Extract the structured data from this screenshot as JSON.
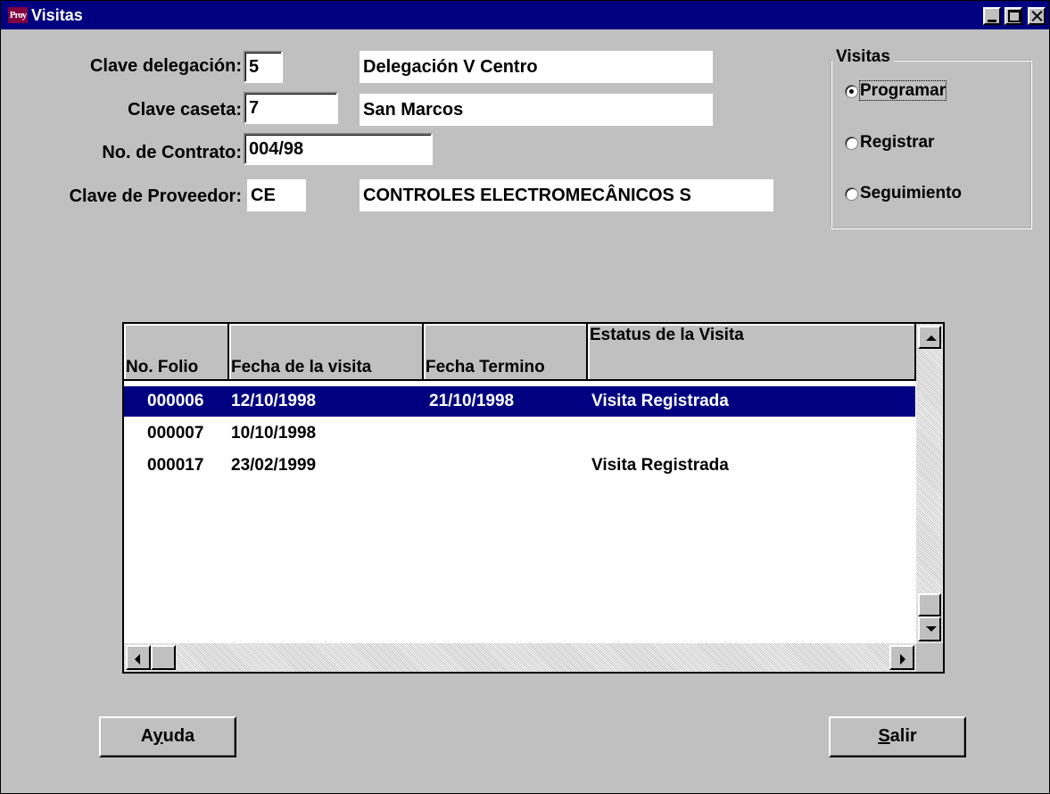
{
  "window": {
    "title": "Visitas",
    "icon_text": "Proy",
    "icon": "app-logo-icon",
    "controls": [
      "minimize-icon",
      "maximize-icon",
      "close-icon"
    ]
  },
  "form": {
    "delegacion_label": "Clave delegación:",
    "delegacion_code": "5",
    "delegacion_name": "Delegación V Centro",
    "caseta_label": "Clave caseta:",
    "caseta_code": "7",
    "caseta_name": "San Marcos",
    "contrato_label": "No. de Contrato:",
    "contrato_value": "004/98",
    "proveedor_label": "Clave de Proveedor:",
    "proveedor_code": "CE",
    "proveedor_name": "CONTROLES ELECTROMECÂNICOS S"
  },
  "visitas_group": {
    "label": "Visitas",
    "options": [
      {
        "label": "Programar",
        "selected": true
      },
      {
        "label": "Registrar",
        "selected": false
      },
      {
        "label": "Seguimiento",
        "selected": false
      }
    ]
  },
  "grid": {
    "columns": [
      "No. Folio",
      "Fecha de la visita",
      "Fecha Termino",
      "Estatus de la Visita"
    ],
    "rows": [
      {
        "folio": "000006",
        "fecha": "12/10/1998",
        "termino": "21/10/1998",
        "estatus": "Visita Registrada",
        "selected": true
      },
      {
        "folio": "000007",
        "fecha": "10/10/1998",
        "termino": "",
        "estatus": "",
        "selected": false
      },
      {
        "folio": "000017",
        "fecha": "23/02/1999",
        "termino": "",
        "estatus": "Visita Registrada",
        "selected": false
      }
    ],
    "selection_color": "#000080"
  },
  "buttons": {
    "ayuda_prefix": "A",
    "ayuda_mnemonic": "y",
    "ayuda_suffix": "uda",
    "salir_mnemonic": "S",
    "salir_suffix": "alir"
  },
  "colors": {
    "titlebar": "#000080",
    "face": "#c0c0c0"
  }
}
